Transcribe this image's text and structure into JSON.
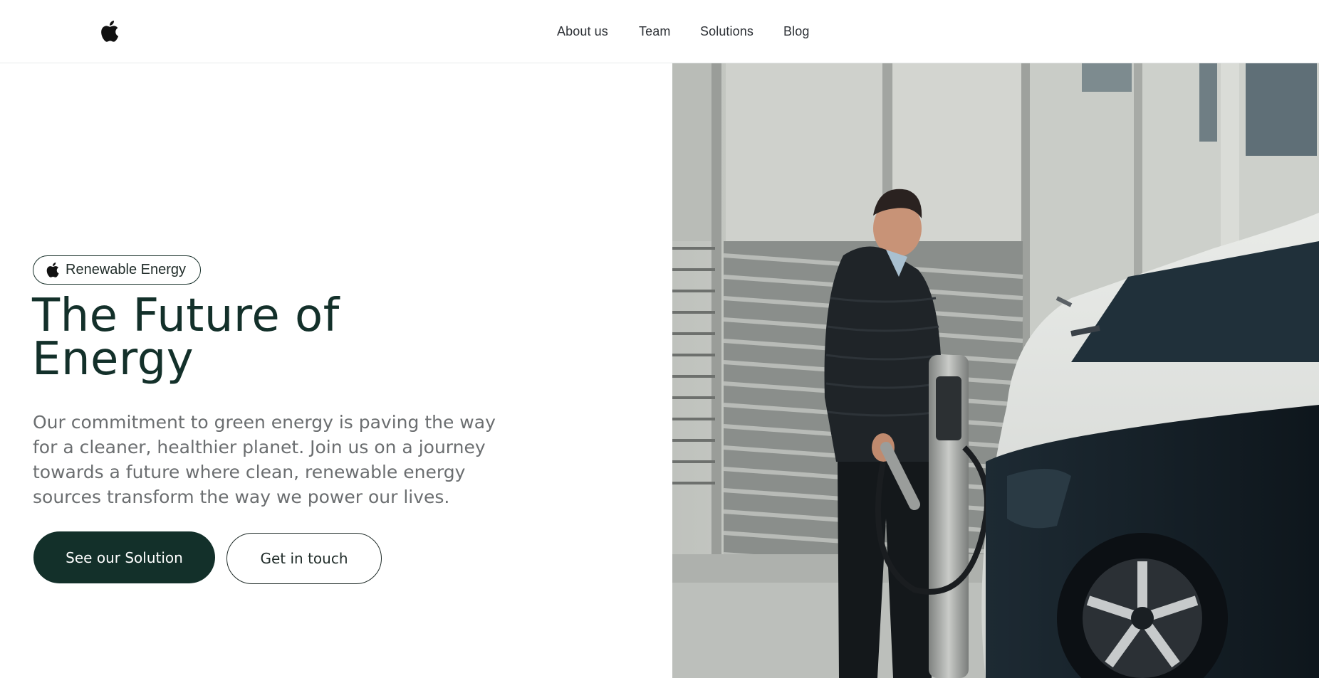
{
  "nav": {
    "logo": "apple-icon",
    "items": [
      {
        "label": "About us"
      },
      {
        "label": "Team"
      },
      {
        "label": "Solutions"
      },
      {
        "label": "Blog"
      }
    ]
  },
  "hero": {
    "badge": {
      "icon": "apple-icon",
      "label": "Renewable Energy"
    },
    "title_line1": "The Future of",
    "title_line2": "Energy",
    "description": "Our commitment to green energy is paving the way for a cleaner, healthier planet. Join us on a journey towards a future where clean, renewable energy sources transform the way we power our lives.",
    "primary_button": "See our Solution",
    "secondary_button": "Get in touch"
  },
  "colors": {
    "brand_dark_green": "#13302a",
    "nav_text": "#2d3136",
    "description_text": "#6b6e70",
    "background": "#ffffff"
  }
}
